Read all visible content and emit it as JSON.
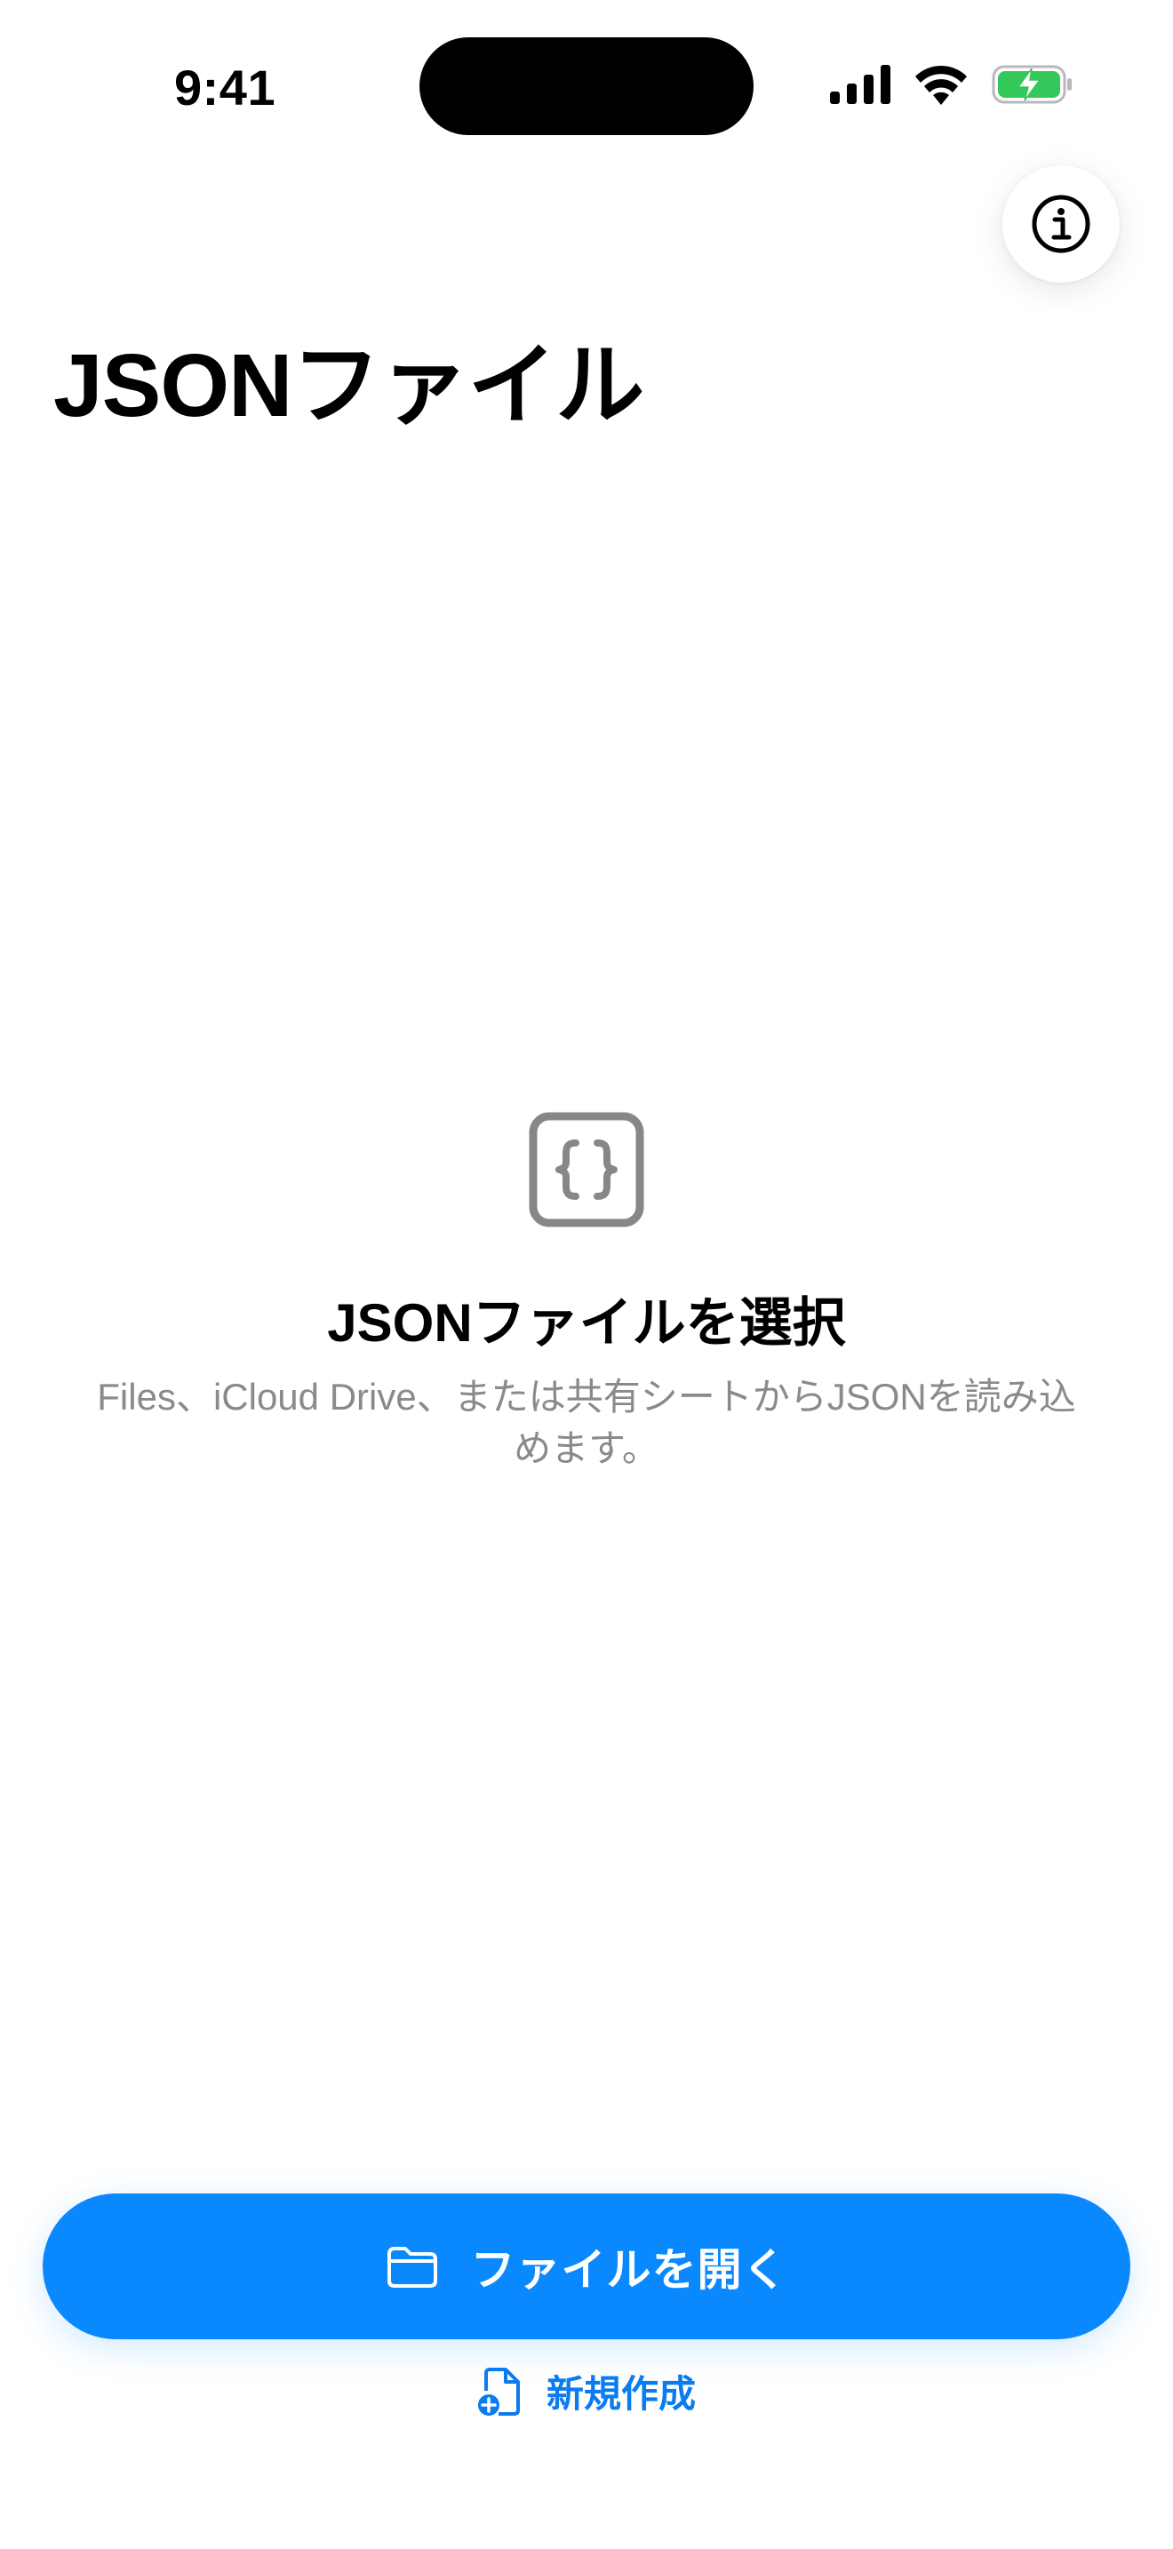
{
  "status_bar": {
    "time": "9:41"
  },
  "header": {
    "title": "JSONファイル",
    "info_icon": "info-circle-icon"
  },
  "empty_state": {
    "icon": "curly-braces-icon",
    "title": "JSONファイルを選択",
    "description": "Files、iCloud Drive、または共有シートからJSONを読み込めます。"
  },
  "actions": {
    "open_label": "ファイルを開く",
    "open_icon": "folder-icon",
    "new_label": "新規作成",
    "new_icon": "new-document-icon"
  },
  "colors": {
    "accent": "#0A89FF",
    "battery": "#34C759",
    "secondary_text": "#8A8A8E"
  }
}
